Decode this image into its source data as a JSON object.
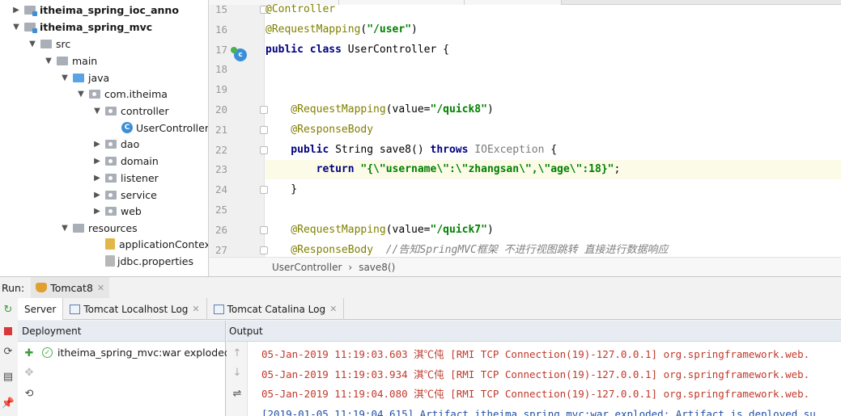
{
  "project_tree": [
    {
      "label": "itheima_spring_ioc_anno",
      "depth": 0,
      "arrow": "▶",
      "icon": "module-folder-icon",
      "bold": true
    },
    {
      "label": "itheima_spring_mvc",
      "depth": 0,
      "arrow": "▼",
      "icon": "module-folder-icon",
      "bold": true
    },
    {
      "label": "src",
      "depth": 1,
      "arrow": "▼",
      "icon": "folder-icon"
    },
    {
      "label": "main",
      "depth": 2,
      "arrow": "▼",
      "icon": "folder-icon"
    },
    {
      "label": "java",
      "depth": 3,
      "arrow": "▼",
      "icon": "source-folder-icon"
    },
    {
      "label": "com.itheima",
      "depth": 4,
      "arrow": "▼",
      "icon": "package-icon"
    },
    {
      "label": "controller",
      "depth": 5,
      "arrow": "▼",
      "icon": "package-icon"
    },
    {
      "label": "UserController",
      "depth": 6,
      "arrow": "",
      "icon": "class-icon"
    },
    {
      "label": "dao",
      "depth": 5,
      "arrow": "▶",
      "icon": "package-icon"
    },
    {
      "label": "domain",
      "depth": 5,
      "arrow": "▶",
      "icon": "package-icon"
    },
    {
      "label": "listener",
      "depth": 5,
      "arrow": "▶",
      "icon": "package-icon"
    },
    {
      "label": "service",
      "depth": 5,
      "arrow": "▶",
      "icon": "package-icon"
    },
    {
      "label": "web",
      "depth": 5,
      "arrow": "▶",
      "icon": "package-icon"
    },
    {
      "label": "resources",
      "depth": 3,
      "arrow": "▼",
      "icon": "resources-folder-icon"
    },
    {
      "label": "applicationContext.xm",
      "depth": 5,
      "arrow": "",
      "icon": "xml-file-icon"
    },
    {
      "label": "jdbc.properties",
      "depth": 5,
      "arrow": "",
      "icon": "properties-file-icon"
    }
  ],
  "editor": {
    "lines": [
      {
        "num": "15",
        "tokens": [
          {
            "t": "@Controller",
            "c": "ann"
          }
        ]
      },
      {
        "num": "16",
        "tokens": [
          {
            "t": "@RequestMapping",
            "c": "ann"
          },
          {
            "t": "(",
            "c": "cls"
          },
          {
            "t": "\"/user\"",
            "c": "str"
          },
          {
            "t": ")",
            "c": "cls"
          }
        ]
      },
      {
        "num": "17",
        "tokens": [
          {
            "t": "public class ",
            "c": "kw"
          },
          {
            "t": "UserController {",
            "c": "cls"
          }
        ]
      },
      {
        "num": "18",
        "tokens": []
      },
      {
        "num": "19",
        "tokens": []
      },
      {
        "num": "20",
        "tokens": [
          {
            "t": "    @RequestMapping",
            "c": "ann"
          },
          {
            "t": "(value=",
            "c": "cls"
          },
          {
            "t": "\"/quick8\"",
            "c": "str"
          },
          {
            "t": ")",
            "c": "cls"
          }
        ]
      },
      {
        "num": "21",
        "tokens": [
          {
            "t": "    @ResponseBody",
            "c": "ann"
          }
        ]
      },
      {
        "num": "22",
        "tokens": [
          {
            "t": "    public ",
            "c": "kw"
          },
          {
            "t": "String save8() ",
            "c": "cls"
          },
          {
            "t": "throws ",
            "c": "kw"
          },
          {
            "t": "IOException",
            "c": "gray"
          },
          {
            "t": " {",
            "c": "cls"
          }
        ]
      },
      {
        "num": "23",
        "tokens": [
          {
            "t": "        return ",
            "c": "kw"
          },
          {
            "t": "\"{\\\"username\\\":\\\"zhangsan\\\",\\\"age\\\":18}\"",
            "c": "str"
          },
          {
            "t": ";",
            "c": "cls"
          }
        ],
        "highlight": true
      },
      {
        "num": "24",
        "tokens": [
          {
            "t": "    }",
            "c": "cls"
          }
        ]
      },
      {
        "num": "25",
        "tokens": []
      },
      {
        "num": "26",
        "tokens": [
          {
            "t": "    @RequestMapping",
            "c": "ann"
          },
          {
            "t": "(value=",
            "c": "cls"
          },
          {
            "t": "\"/quick7\"",
            "c": "str"
          },
          {
            "t": ")",
            "c": "cls"
          }
        ]
      },
      {
        "num": "27",
        "tokens": [
          {
            "t": "    @ResponseBody  ",
            "c": "ann"
          },
          {
            "t": "//告知SpringMVC框架 不进行视图跳转 直接进行数据响应",
            "c": "cmt"
          }
        ]
      }
    ],
    "breadcrumb": [
      "UserController",
      "›",
      "save8()"
    ]
  },
  "run_panel": {
    "label": "Run:",
    "config_tab": "Tomcat8",
    "subtabs": [
      "Server",
      "Tomcat Localhost Log",
      "Tomcat Catalina Log"
    ],
    "deployment_header": "Deployment",
    "deployment_item": "itheima_spring_mvc:war exploded",
    "output_header": "Output",
    "output_lines": [
      {
        "text": "05-Jan-2019 11:19:03.603 淇℃伅 [RMI TCP Connection(19)-127.0.0.1] org.springframework.web.",
        "kind": "err"
      },
      {
        "text": "05-Jan-2019 11:19:03.934 淇℃伅 [RMI TCP Connection(19)-127.0.0.1] org.springframework.web.",
        "kind": "err"
      },
      {
        "text": "05-Jan-2019 11:19:04.080 淇℃伅 [RMI TCP Connection(19)-127.0.0.1] org.springframework.web.",
        "kind": "err"
      },
      {
        "text": "[2019-01-05 11:19:04,615] Artifact itheima_spring_mvc:war exploded: Artifact is deployed su",
        "kind": "info"
      }
    ]
  },
  "colors": {
    "accent": "#3b8fd9",
    "error_text": "#c0392b",
    "info_text": "#1f4fa8"
  }
}
